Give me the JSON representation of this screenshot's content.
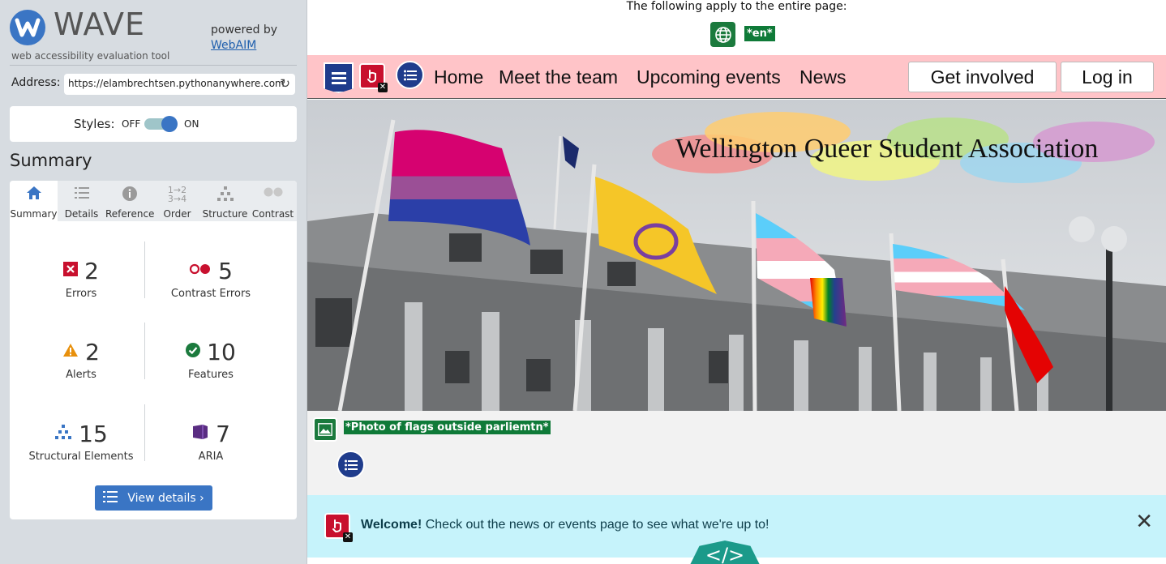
{
  "wave": {
    "logo_text": "WAVE",
    "tagline": "web accessibility evaluation tool",
    "powered_by": "powered by",
    "webaim_link": "WebAIM",
    "address_label": "Address:",
    "address_value": "https://elambrechtsen.pythonanywhere.com",
    "styles_label": "Styles:",
    "styles_off": "OFF",
    "styles_on": "ON",
    "styles_state": "on",
    "summary_title": "Summary",
    "tabs": [
      {
        "label": "Summary",
        "icon": "home-icon",
        "active": true
      },
      {
        "label": "Details",
        "icon": "list-icon"
      },
      {
        "label": "Reference",
        "icon": "info-icon"
      },
      {
        "label": "Order",
        "icon": "order-icon"
      },
      {
        "label": "Structure",
        "icon": "structure-icon"
      },
      {
        "label": "Contrast",
        "icon": "contrast-icon"
      }
    ],
    "stats": {
      "errors": {
        "count": "2",
        "label": "Errors"
      },
      "contrast_errors": {
        "count": "5",
        "label": "Contrast Errors"
      },
      "alerts": {
        "count": "2",
        "label": "Alerts"
      },
      "features": {
        "count": "10",
        "label": "Features"
      },
      "structural": {
        "count": "15",
        "label": "Structural Elements"
      },
      "aria": {
        "count": "7",
        "label": "ARIA"
      }
    },
    "view_details": "View details ›"
  },
  "preview": {
    "entire_page_note": "The following apply to the entire page:",
    "lang_tag": "*en*",
    "nav": {
      "links": [
        "Home",
        "Meet the team",
        "Upcoming events",
        "News"
      ],
      "get_involved": "Get involved",
      "login": "Log in"
    },
    "hero_title": "Wellington Queer Student Association",
    "alt_text": "*Photo of flags outside parliemtn*",
    "welcome_bold": "Welcome!",
    "welcome_text": " Check out the news or events page to see what we're up to!",
    "code_toggle": "</>"
  },
  "colors": {
    "wave_blue": "#3a75c4",
    "error_red": "#c8102e",
    "feature_green": "#1b7a3d",
    "structure_navy": "#1f3c8c",
    "aria_purple": "#5a2d82",
    "nav_pink": "#ffc4c8",
    "welcome_cyan": "#c6f3fb"
  }
}
